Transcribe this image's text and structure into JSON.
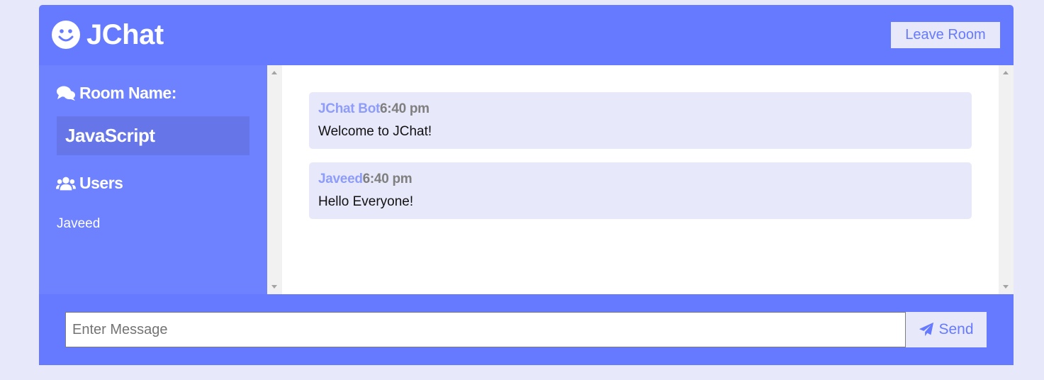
{
  "header": {
    "logo_icon": "smile-icon",
    "app_title": "JChat",
    "leave_button_label": "Leave Room"
  },
  "sidebar": {
    "room_heading_icon": "comments-icon",
    "room_heading": "Room Name:",
    "room_name": "JavaScript",
    "users_heading_icon": "users-icon",
    "users_heading": "Users",
    "users": [
      "Javeed"
    ]
  },
  "messages": [
    {
      "user": "JChat Bot",
      "time": "6:40 pm",
      "text": "Welcome to JChat!"
    },
    {
      "user": "Javeed",
      "time": "6:40 pm",
      "text": "Hello Everyone!"
    }
  ],
  "footer": {
    "input_placeholder": "Enter Message",
    "input_value": "",
    "send_icon": "paper-plane-icon",
    "send_label": "Send"
  },
  "colors": {
    "primary": "#667aff",
    "sidebar": "#6e81ff",
    "room_highlight": "#6675e8",
    "light": "#e7e8fa",
    "username": "#8e9dfa",
    "time": "#7f7f7f"
  }
}
